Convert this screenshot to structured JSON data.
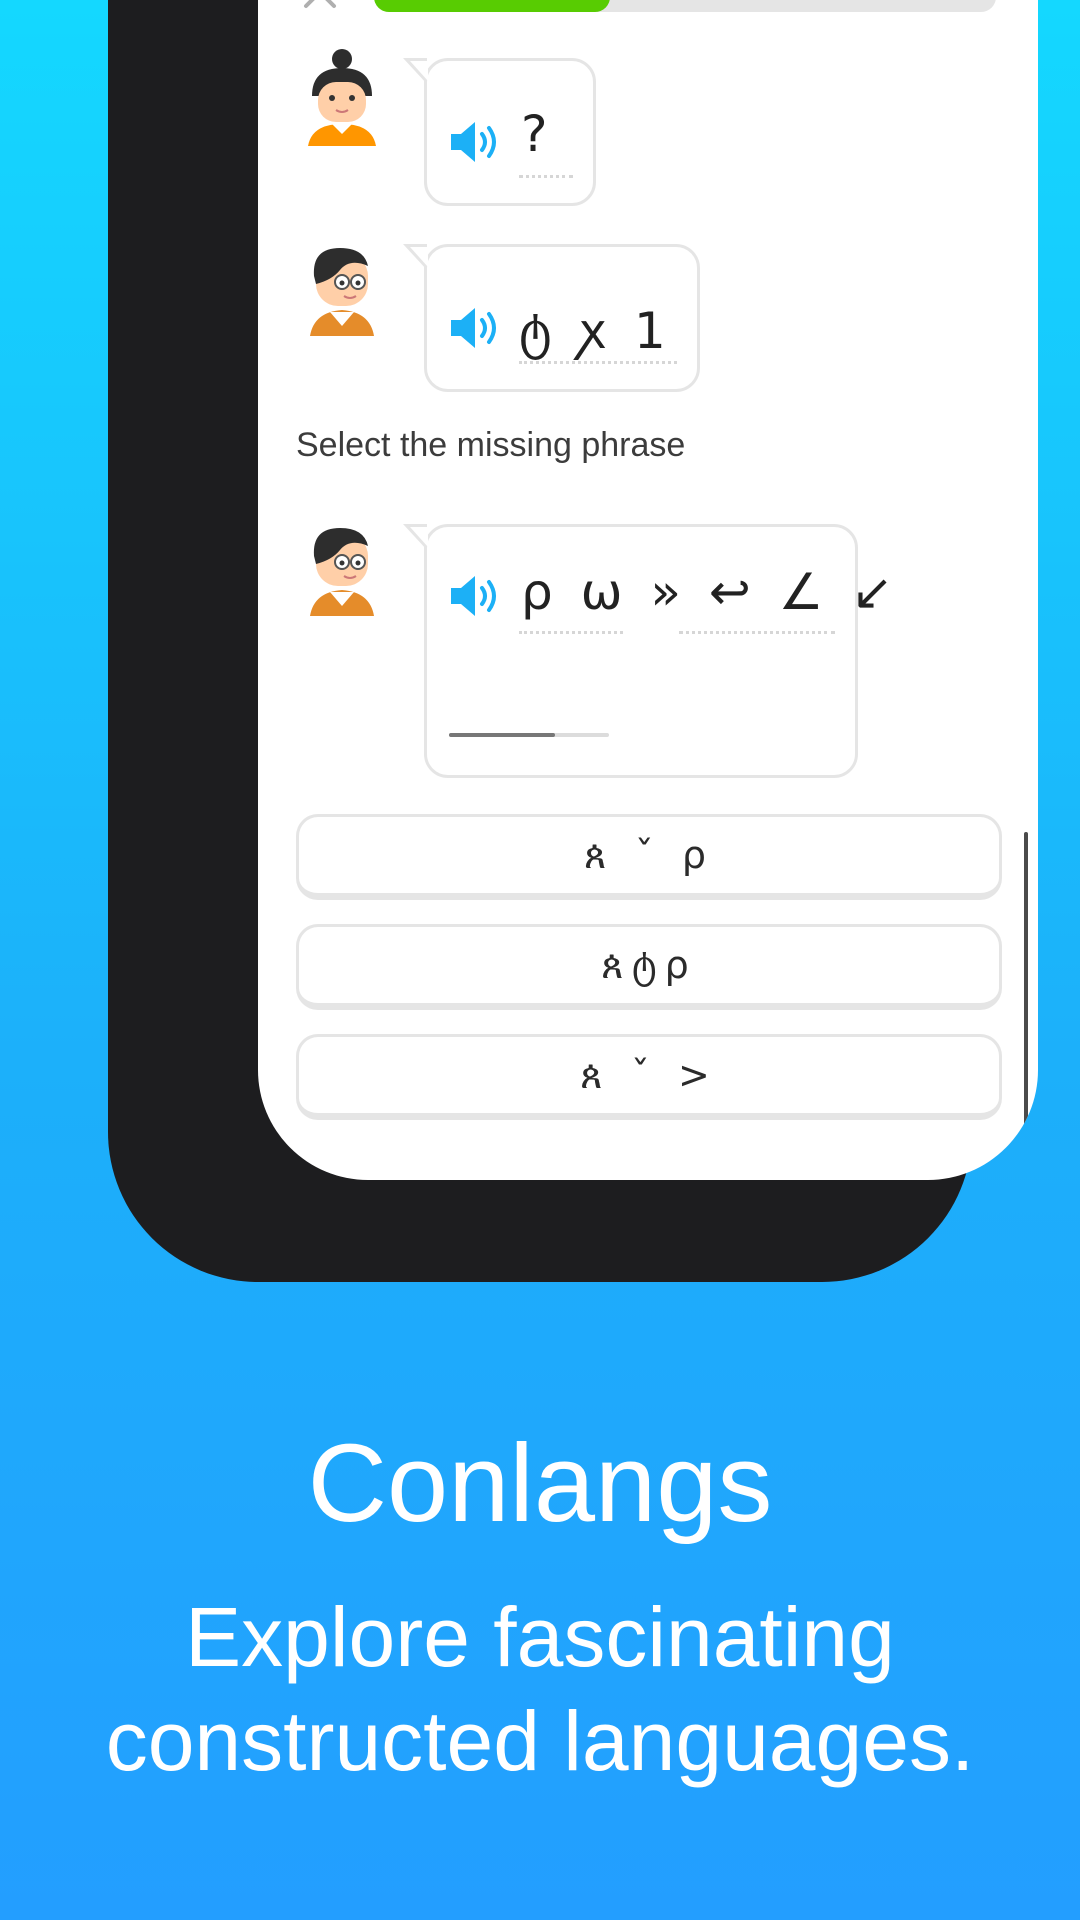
{
  "lesson": {
    "progress_fraction": 0.38,
    "dialogue": [
      {
        "speaker": "woman-with-bun-avatar",
        "glyphs": "?"
      },
      {
        "speaker": "boy-avatar",
        "glyphs": "ტ ꭗ 1"
      }
    ],
    "instruction": "Select the missing phrase",
    "prompt": {
      "speaker": "boy-avatar",
      "glyphs": "ρ ω » ↩ ∠ ↙"
    },
    "options": [
      {
        "label": "ጰ ˇ ρ"
      },
      {
        "label": "ጰტρ"
      },
      {
        "label": "ጰ ˇ >"
      }
    ]
  },
  "promo": {
    "title": "Conlangs",
    "subtitle_line1": "Explore fascinating",
    "subtitle_line2": "constructed languages."
  },
  "colors": {
    "progress_green": "#58cc02",
    "speaker_blue": "#1cb0f6",
    "background_top": "#14D8FF",
    "background_bottom": "#239EFF"
  }
}
